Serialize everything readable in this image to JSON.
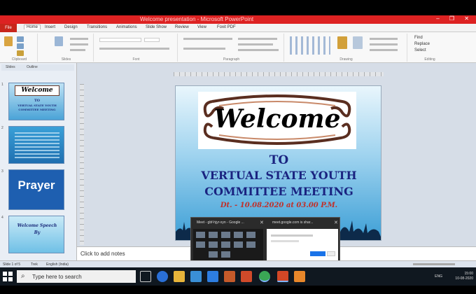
{
  "window": {
    "title": "Welcome presentation - Microsoft PowerPoint"
  },
  "ribbon": {
    "file_tab": "File",
    "tabs": [
      "Home",
      "Insert",
      "Design",
      "Transitions",
      "Animations",
      "Slide Show",
      "Review",
      "View",
      "Foxit PDF"
    ],
    "groups": [
      "Clipboard",
      "Slides",
      "Font",
      "Paragraph",
      "Drawing",
      "Editing"
    ],
    "editing_items": [
      "Find",
      "Replace",
      "Select"
    ]
  },
  "pane": {
    "tab_slides": "Slides",
    "tab_outline": "Outline",
    "thumbnails": [
      {
        "number": "1",
        "welcome": "Welcome",
        "line1": "TO",
        "line2": "VERTUAL STATE YOUTH",
        "line3": "COMMITTEE MEETING"
      },
      {
        "number": "2"
      },
      {
        "number": "3",
        "text": "Prayer"
      },
      {
        "number": "4",
        "line1": "Welcome Speech",
        "line2": "By"
      }
    ]
  },
  "slide": {
    "welcome": "Welcome",
    "to": "TO",
    "line1": "VERTUAL STATE YOUTH",
    "line2": "COMMITTEE MEETING",
    "date": "Dt. -  10.08.2020 at 03.00 P.M."
  },
  "notes": {
    "placeholder": "Click to add notes"
  },
  "popup": {
    "title_left": "Meet - gbf-hjyr-xyn - Google ...",
    "title_right": "meet.google.com is shar..."
  },
  "status": {
    "slide_info": "Slide 1 of 5",
    "theme": "Trek",
    "language": "English (India)"
  },
  "taskbar": {
    "search_placeholder": "Type here to search",
    "language": "ENG",
    "time": "15:00",
    "date": "10-08-2020"
  },
  "colors": {
    "titlebar": "#dd2222",
    "slide_text": "#1a2380",
    "date_text": "#c0302a",
    "taskbar": "#101820"
  }
}
